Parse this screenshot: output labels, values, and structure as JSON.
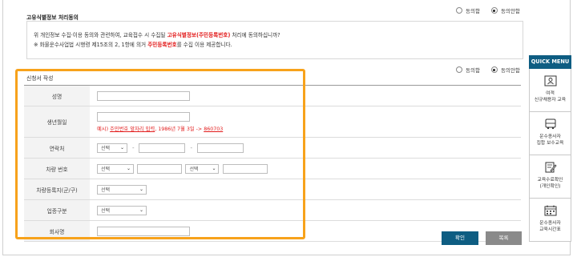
{
  "section1": {
    "title": "고유식별정보 처리동의",
    "agree_label": "동의함",
    "disagree_label": "동의안함",
    "line1_pre": "위 개인정보 수집·이용 동의와 관련하여, 교육접수 시 수집될 ",
    "line1_red": "고유식별정보(주민등록번호)",
    "line1_post": " 처리에 동의하십니까?",
    "line2_pre": "※ 화물운수사업법 시행령 제15조의 2, 1항에 의거 ",
    "line2_red": "주민등록번호",
    "line2_post": "를 수집 이용 제공합니다."
  },
  "section2": {
    "agree_label": "동의함",
    "disagree_label": "동의안함",
    "title": "신청서 작성"
  },
  "form": {
    "name_label": "성명",
    "birth_label": "생년월일",
    "birth_example_pre": "예시) ",
    "birth_example_link": "주민번호 앞자리 입력",
    "birth_example_mid": ", 1986년 7월 3일 -> ",
    "birth_example_value": "860703",
    "contact_label": "연락처",
    "contact_select": "선택",
    "contact_dash1": "-",
    "contact_dash2": "-",
    "vehicle_label": "차량 번호",
    "vehicle_select1": "선택",
    "vehicle_select2": "선택",
    "region_label": "차량등록지(군/구)",
    "region_select": "선택",
    "business_label": "업종구분",
    "business_select": "선택",
    "company_label": "회사명"
  },
  "buttons": {
    "confirm": "확인",
    "cancel": "복록"
  },
  "quick_menu": {
    "title": "QUICK MENU",
    "items": [
      {
        "icon": "id-card-icon",
        "line1": "여객",
        "line2": "신규채용자 교육"
      },
      {
        "icon": "bus-icon",
        "line1": "운수종사자",
        "line2": "집합 보수교육"
      },
      {
        "icon": "certificate-edit-icon",
        "line1": "교육수료확인",
        "line2": "(개인확인)"
      },
      {
        "icon": "calendar-icon",
        "line1": "운수종사자",
        "line2": "교육시간표"
      }
    ]
  },
  "colors": {
    "accent_red": "#e21b1b",
    "highlight_orange": "#f7a21b",
    "confirm_button": "#0e5d82",
    "cancel_button": "#8a8a8a",
    "quick_menu_header": "#0e5d82"
  }
}
